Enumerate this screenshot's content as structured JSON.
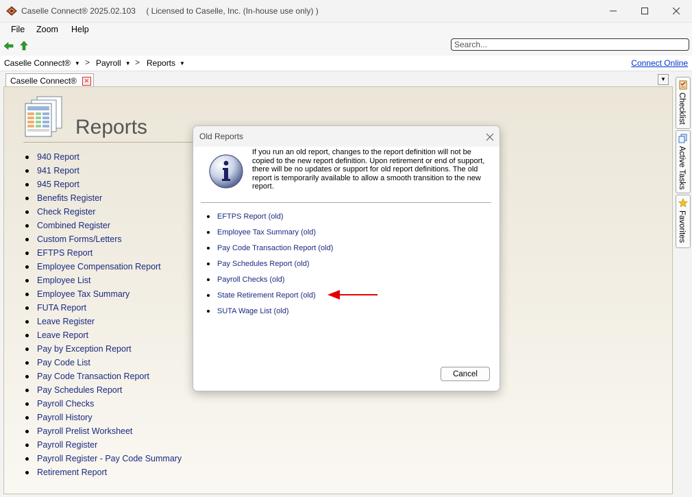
{
  "window": {
    "title": "Caselle Connect® 2025.02.103",
    "license": "( Licensed to Caselle, Inc. (In-house use only) )"
  },
  "menu": [
    "File",
    "Zoom",
    "Help"
  ],
  "search": {
    "placeholder": "Search..."
  },
  "breadcrumb": [
    {
      "label": "Caselle Connect®"
    },
    {
      "label": "Payroll"
    },
    {
      "label": "Reports"
    }
  ],
  "breadcrumb_sep": ">",
  "connect_online": "Connect Online",
  "tab": {
    "label": "Caselle Connect®"
  },
  "page_title": "Reports",
  "reports": [
    "940 Report",
    "941 Report",
    "945 Report",
    "Benefits Register",
    "Check Register",
    "Combined Register",
    "Custom Forms/Letters",
    "EFTPS Report",
    "Employee Compensation Report",
    "Employee List",
    "Employee Tax Summary",
    "FUTA Report",
    "Leave Register",
    "Leave Report",
    "Pay by Exception Report",
    "Pay Code List",
    "Pay Code Transaction Report",
    "Pay Schedules Report",
    "Payroll Checks",
    "Payroll History",
    "Payroll Prelist Worksheet",
    "Payroll Register",
    "Payroll Register - Pay Code Summary",
    "Retirement Report"
  ],
  "side_tabs": [
    "Checklist",
    "Active Tasks",
    "Favorites"
  ],
  "dialog": {
    "title": "Old Reports",
    "message": "If you run an old report, changes to the report definition will not be copied to the new report definition. Upon retirement or end of support, there will be no updates or support for old report definitions. The old report is temporarily available to allow a smooth transition to the new report.",
    "items": [
      "EFTPS Report (old)",
      "Employee Tax Summary (old)",
      "Pay Code Transaction Report (old)",
      "Pay Schedules Report (old)",
      "Payroll Checks (old)",
      "State Retirement Report (old)",
      "SUTA Wage List (old)"
    ],
    "cancel_label": "Cancel"
  },
  "colors": {
    "link": "#1a2a80",
    "connect_link": "#0033cc",
    "highlight_arrow": "#e00000",
    "back_arrow": "#2e9e2e",
    "up_arrow": "#2e9e2e"
  }
}
